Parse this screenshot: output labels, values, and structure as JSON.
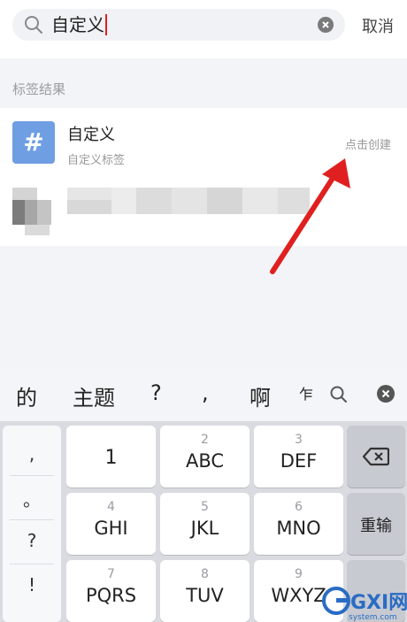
{
  "search": {
    "query": "自定义",
    "cancel_label": "取消"
  },
  "section": {
    "label": "标签结果"
  },
  "result": {
    "icon_symbol": "#",
    "title": "自定义",
    "subtitle": "自定义标签",
    "action_label": "点击创建"
  },
  "candidates": [
    "的",
    "主题",
    "?",
    ",",
    "啊",
    "乍"
  ],
  "keyboard": {
    "punctuation": [
      ",",
      "。",
      "?",
      "!"
    ],
    "keys": [
      {
        "num": "",
        "label": "1"
      },
      {
        "num": "2",
        "label": "ABC"
      },
      {
        "num": "3",
        "label": "DEF"
      },
      {
        "num": "4",
        "label": "GHI"
      },
      {
        "num": "5",
        "label": "JKL"
      },
      {
        "num": "6",
        "label": "MNO"
      },
      {
        "num": "7",
        "label": "PQRS"
      },
      {
        "num": "8",
        "label": "TUV"
      },
      {
        "num": "9",
        "label": "WXYZ"
      }
    ],
    "retype_label": "重输"
  },
  "watermark": {
    "text": "GXI网",
    "sub": "system.com"
  },
  "colors": {
    "accent_red": "#e02020",
    "tag_blue": "#6f9ee2"
  }
}
